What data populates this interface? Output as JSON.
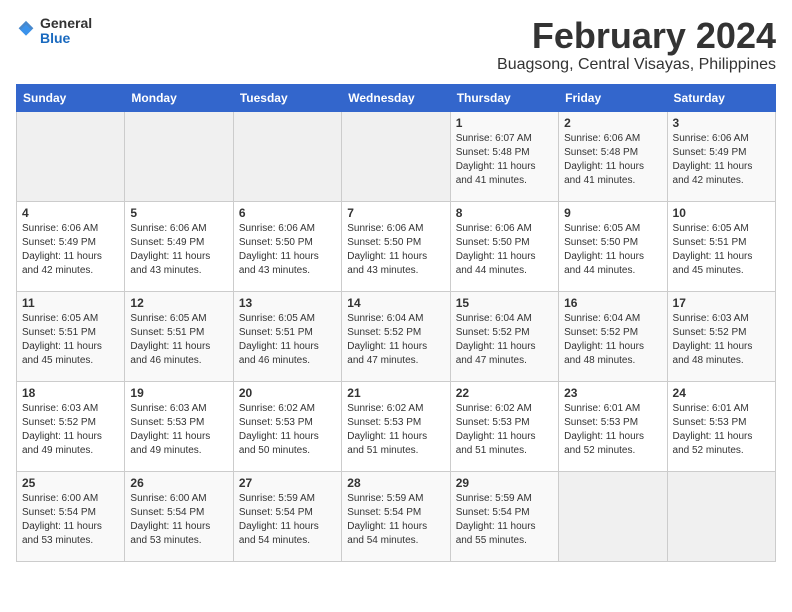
{
  "header": {
    "logo": {
      "general": "General",
      "blue": "Blue"
    },
    "title": "February 2024",
    "location": "Buagsong, Central Visayas, Philippines"
  },
  "calendar": {
    "days_of_week": [
      "Sunday",
      "Monday",
      "Tuesday",
      "Wednesday",
      "Thursday",
      "Friday",
      "Saturday"
    ],
    "weeks": [
      [
        {
          "day": "",
          "info": ""
        },
        {
          "day": "",
          "info": ""
        },
        {
          "day": "",
          "info": ""
        },
        {
          "day": "",
          "info": ""
        },
        {
          "day": "1",
          "info": "Sunrise: 6:07 AM\nSunset: 5:48 PM\nDaylight: 11 hours and 41 minutes."
        },
        {
          "day": "2",
          "info": "Sunrise: 6:06 AM\nSunset: 5:48 PM\nDaylight: 11 hours and 41 minutes."
        },
        {
          "day": "3",
          "info": "Sunrise: 6:06 AM\nSunset: 5:49 PM\nDaylight: 11 hours and 42 minutes."
        }
      ],
      [
        {
          "day": "4",
          "info": "Sunrise: 6:06 AM\nSunset: 5:49 PM\nDaylight: 11 hours and 42 minutes."
        },
        {
          "day": "5",
          "info": "Sunrise: 6:06 AM\nSunset: 5:49 PM\nDaylight: 11 hours and 43 minutes."
        },
        {
          "day": "6",
          "info": "Sunrise: 6:06 AM\nSunset: 5:50 PM\nDaylight: 11 hours and 43 minutes."
        },
        {
          "day": "7",
          "info": "Sunrise: 6:06 AM\nSunset: 5:50 PM\nDaylight: 11 hours and 43 minutes."
        },
        {
          "day": "8",
          "info": "Sunrise: 6:06 AM\nSunset: 5:50 PM\nDaylight: 11 hours and 44 minutes."
        },
        {
          "day": "9",
          "info": "Sunrise: 6:05 AM\nSunset: 5:50 PM\nDaylight: 11 hours and 44 minutes."
        },
        {
          "day": "10",
          "info": "Sunrise: 6:05 AM\nSunset: 5:51 PM\nDaylight: 11 hours and 45 minutes."
        }
      ],
      [
        {
          "day": "11",
          "info": "Sunrise: 6:05 AM\nSunset: 5:51 PM\nDaylight: 11 hours and 45 minutes."
        },
        {
          "day": "12",
          "info": "Sunrise: 6:05 AM\nSunset: 5:51 PM\nDaylight: 11 hours and 46 minutes."
        },
        {
          "day": "13",
          "info": "Sunrise: 6:05 AM\nSunset: 5:51 PM\nDaylight: 11 hours and 46 minutes."
        },
        {
          "day": "14",
          "info": "Sunrise: 6:04 AM\nSunset: 5:52 PM\nDaylight: 11 hours and 47 minutes."
        },
        {
          "day": "15",
          "info": "Sunrise: 6:04 AM\nSunset: 5:52 PM\nDaylight: 11 hours and 47 minutes."
        },
        {
          "day": "16",
          "info": "Sunrise: 6:04 AM\nSunset: 5:52 PM\nDaylight: 11 hours and 48 minutes."
        },
        {
          "day": "17",
          "info": "Sunrise: 6:03 AM\nSunset: 5:52 PM\nDaylight: 11 hours and 48 minutes."
        }
      ],
      [
        {
          "day": "18",
          "info": "Sunrise: 6:03 AM\nSunset: 5:52 PM\nDaylight: 11 hours and 49 minutes."
        },
        {
          "day": "19",
          "info": "Sunrise: 6:03 AM\nSunset: 5:53 PM\nDaylight: 11 hours and 49 minutes."
        },
        {
          "day": "20",
          "info": "Sunrise: 6:02 AM\nSunset: 5:53 PM\nDaylight: 11 hours and 50 minutes."
        },
        {
          "day": "21",
          "info": "Sunrise: 6:02 AM\nSunset: 5:53 PM\nDaylight: 11 hours and 51 minutes."
        },
        {
          "day": "22",
          "info": "Sunrise: 6:02 AM\nSunset: 5:53 PM\nDaylight: 11 hours and 51 minutes."
        },
        {
          "day": "23",
          "info": "Sunrise: 6:01 AM\nSunset: 5:53 PM\nDaylight: 11 hours and 52 minutes."
        },
        {
          "day": "24",
          "info": "Sunrise: 6:01 AM\nSunset: 5:53 PM\nDaylight: 11 hours and 52 minutes."
        }
      ],
      [
        {
          "day": "25",
          "info": "Sunrise: 6:00 AM\nSunset: 5:54 PM\nDaylight: 11 hours and 53 minutes."
        },
        {
          "day": "26",
          "info": "Sunrise: 6:00 AM\nSunset: 5:54 PM\nDaylight: 11 hours and 53 minutes."
        },
        {
          "day": "27",
          "info": "Sunrise: 5:59 AM\nSunset: 5:54 PM\nDaylight: 11 hours and 54 minutes."
        },
        {
          "day": "28",
          "info": "Sunrise: 5:59 AM\nSunset: 5:54 PM\nDaylight: 11 hours and 54 minutes."
        },
        {
          "day": "29",
          "info": "Sunrise: 5:59 AM\nSunset: 5:54 PM\nDaylight: 11 hours and 55 minutes."
        },
        {
          "day": "",
          "info": ""
        },
        {
          "day": "",
          "info": ""
        }
      ]
    ]
  }
}
